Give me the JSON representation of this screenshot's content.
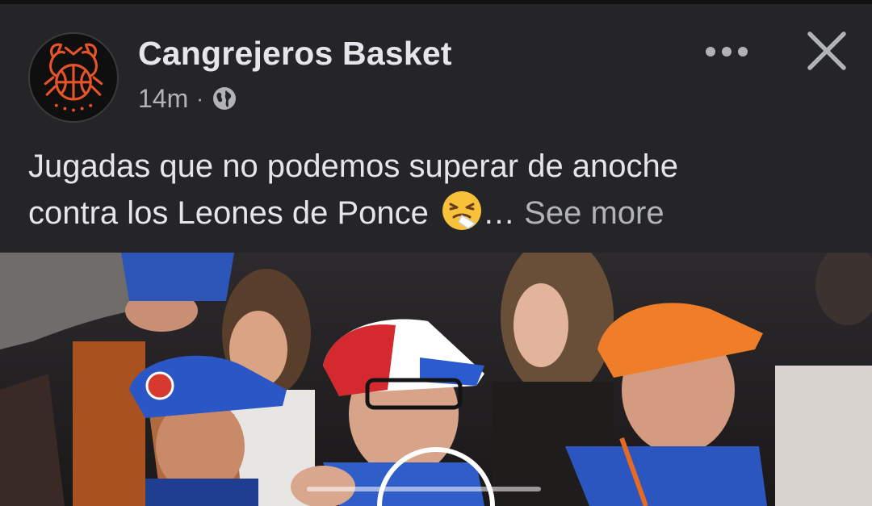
{
  "post": {
    "author": "Cangrejeros Basket",
    "timestamp": "14m",
    "separator": "·",
    "audience_icon": "globe-icon",
    "text_line1": "Jugadas que no podemos superar de anoche",
    "text_line2": "contra los Leones de Ponce",
    "emoji": "sneezing-face-emoji",
    "ellipsis": "…",
    "see_more": "See more"
  },
  "actions": {
    "more_icon": "more-options-icon",
    "close_icon": "close-icon"
  },
  "colors": {
    "background": "#252527",
    "primary_text": "#e4e6eb",
    "secondary_text": "#b0b3b8",
    "logo_orange": "#e8542a"
  }
}
